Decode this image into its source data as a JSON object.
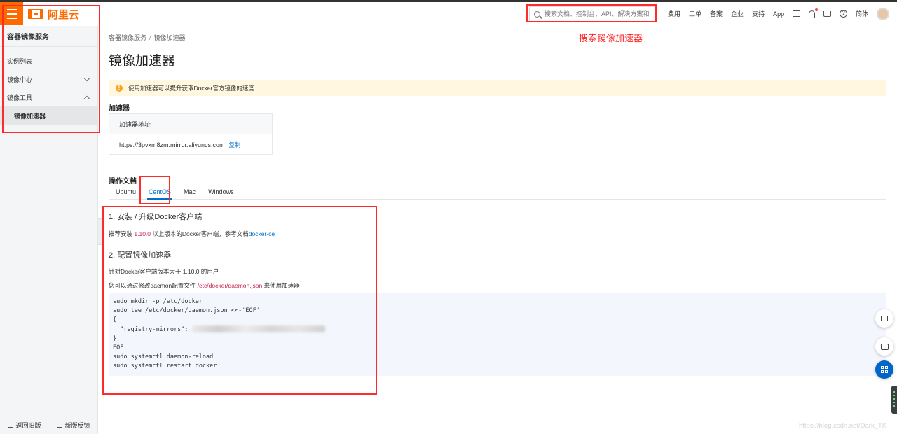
{
  "header": {
    "brand": "阿里云",
    "search_placeholder": "搜索文档、控制台、API、解决方案和资",
    "nav": [
      "费用",
      "工单",
      "备案",
      "企业",
      "支持",
      "App"
    ],
    "language": "简体",
    "annotation_text": "搜索镜像加速器"
  },
  "sidebar": {
    "title": "容器镜像服务",
    "items": [
      {
        "label": "实例列表"
      },
      {
        "label": "镜像中心",
        "expand": "down"
      },
      {
        "label": "镜像工具",
        "expand": "up"
      },
      {
        "label": "镜像加速器",
        "selected": true
      }
    ],
    "bottom_left": "返回旧版",
    "bottom_right": "新版反馈"
  },
  "main": {
    "breadcrumb": [
      "容器镜像服务",
      "镜像加速器"
    ],
    "breadcrumb_sep": "/",
    "title": "镜像加速器",
    "notice": "使用加速器可以提升获取Docker官方镜像的速度",
    "accelerator_section": "加速器",
    "accelerator_header": "加速器地址",
    "accelerator_url": "https://3pvxm8zm.mirror.aliyuncs.com",
    "copy_label": "复制",
    "docs_section": "操作文档",
    "tabs": [
      "Ubuntu",
      "CentOS",
      "Mac",
      "Windows"
    ],
    "active_tab": "CentOS",
    "step1_title": "1. 安装 / 升级Docker客户端",
    "step1_text_a": "推荐安装 ",
    "step1_version": "1.10.0",
    "step1_text_b": " 以上版本的Docker客户端，参考文档",
    "step1_link": "docker-ce",
    "step2_title": "2. 配置镜像加速器",
    "step2_text1": "针对Docker客户端版本大于 1.10.0 的用户",
    "step2_text2_a": "您可以通过修改daemon配置文件 ",
    "step2_path": "/etc/docker/daemon.json",
    "step2_text2_b": " 来使用加速器",
    "code_lines": [
      "sudo mkdir -p /etc/docker",
      "sudo tee /etc/docker/daemon.json <<-'EOF'",
      "{",
      "  \"registry-mirrors\": ",
      "}",
      "EOF",
      "sudo systemctl daemon-reload",
      "sudo systemctl restart docker"
    ]
  },
  "watermark": "https://blog.csdn.net/Dark_TK",
  "colors": {
    "brand_orange": "#ff6a00",
    "annotation_red": "#ff2a2a",
    "link_blue": "#0070cc",
    "notice_bg": "#fff7e0"
  }
}
